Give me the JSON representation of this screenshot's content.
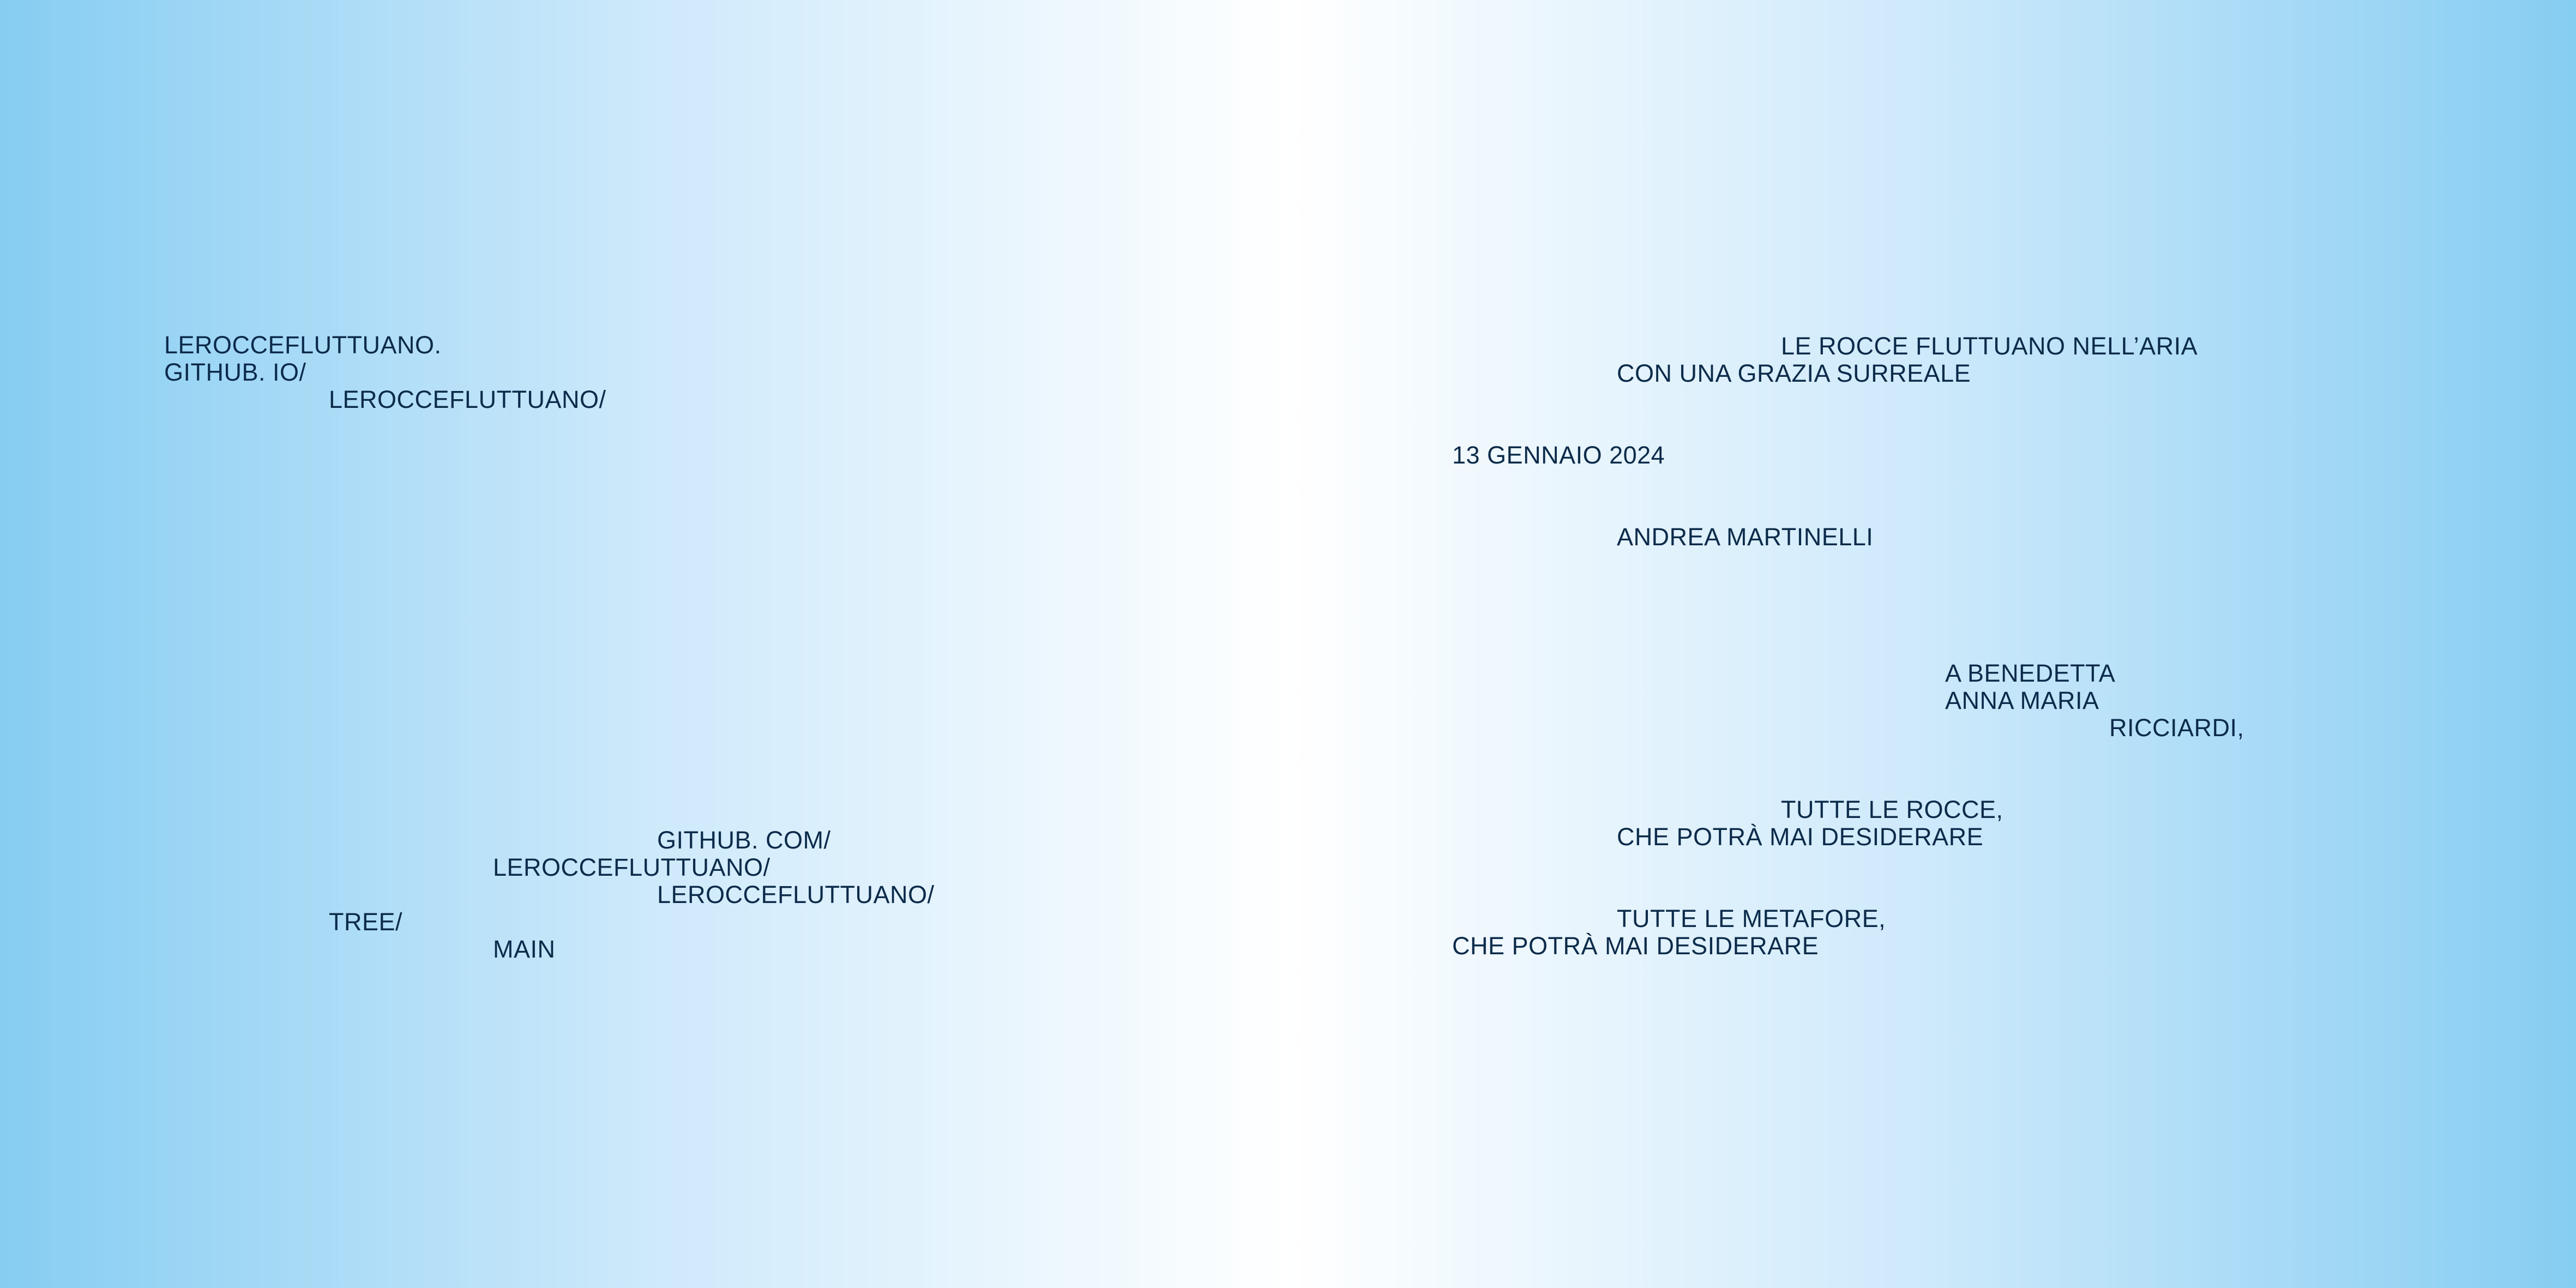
{
  "left_page": {
    "url_block": {
      "line1": "LEROCCEFLUTTUANO.",
      "line2": "GITHUB. IO/",
      "line3": "LEROCCEFLUTTUANO/"
    },
    "repo_block": {
      "line1": "GITHUB. COM/",
      "line2": "LEROCCEFLUTTUANO/",
      "line3": "LEROCCEFLUTTUANO/",
      "line4": "TREE/",
      "line5": "MAIN"
    }
  },
  "right_page": {
    "subtitle": {
      "line1": "LE ROCCE FLUTTUANO NELL’ARIA",
      "line2": "CON UNA GRAZIA SURREALE"
    },
    "date": "13 GENNAIO 2024",
    "author": "ANDREA MARTINELLI",
    "dedication": {
      "line1": "A BENEDETTA",
      "line2": "ANNA MARIA",
      "line3": "RICCIARDI,"
    },
    "stanza1": {
      "line1": "TUTTE LE ROCCE,",
      "line2": "CHE POTRÀ MAI DESIDERARE"
    },
    "stanza2": {
      "line1": "TUTTE LE METAFORE,",
      "line2": "CHE POTRÀ MAI DESIDERARE"
    }
  }
}
